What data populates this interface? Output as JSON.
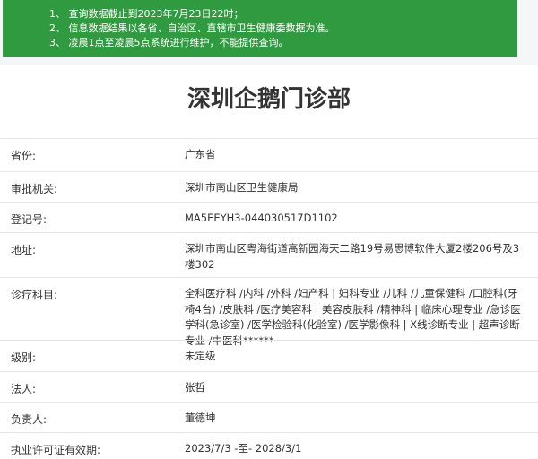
{
  "notice": {
    "lines": [
      "1、 查询数据截止到2023年7月23日22时；",
      "2、 信息数据结果以各省、自治区、直辖市卫生健康委数据为准。",
      "3、 凌晨1点至凌晨5点系统进行维护，不能提供查询。"
    ]
  },
  "title": "深圳企鹅门诊部",
  "fields": [
    {
      "label": "省份:",
      "value": "广东省"
    },
    {
      "label": "审批机关:",
      "value": "深圳市南山区卫生健康局"
    },
    {
      "label": "登记号:",
      "value": "MA5EEYH3-044030517D1102"
    },
    {
      "label": "地址:",
      "value": "深圳市南山区粤海街道高新园海天二路19号易思博软件大厦2楼206号及3楼302"
    },
    {
      "label": "诊疗科目:",
      "value": "全科医疗科 /内科 /外科 /妇产科 | 妇科专业 /儿科 /儿童保健科 /口腔科(牙椅4台) /皮肤科 /医疗美容科 | 美容皮肤科 /精神科 | 临床心理专业 /急诊医学科(急诊室) /医学检验科(化验室) /医学影像科 | X线诊断专业 | 超声诊断专业 /中医科******"
    },
    {
      "label": "级别:",
      "value": "未定级"
    },
    {
      "label": "法人:",
      "value": "张哲"
    },
    {
      "label": "负责人:",
      "value": "董德坤"
    },
    {
      "label": "执业许可证有效期:",
      "value": "2023/7/3 -至- 2028/3/1"
    }
  ]
}
